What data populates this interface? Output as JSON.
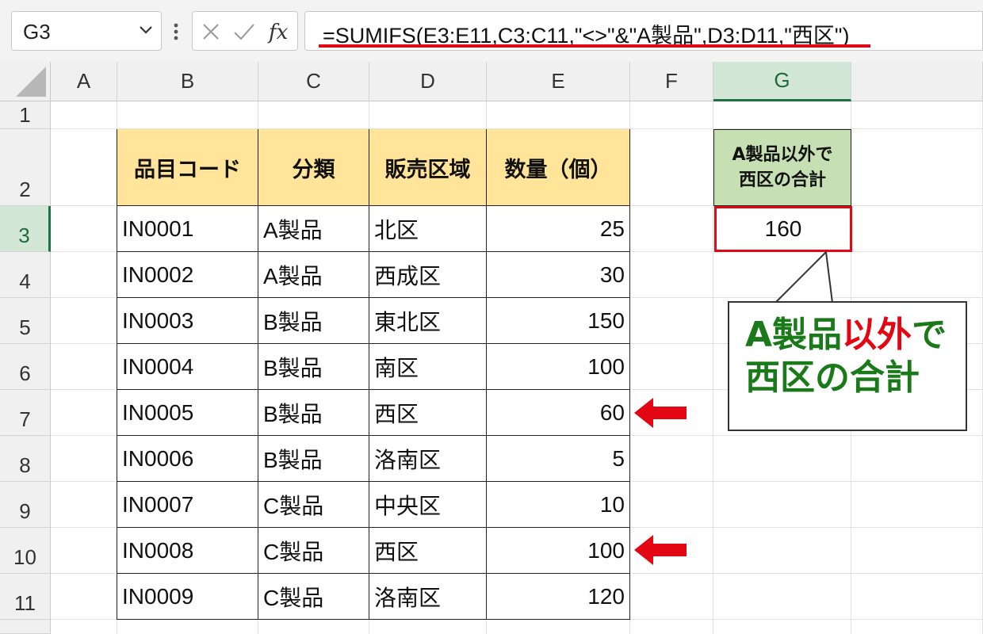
{
  "formula_bar": {
    "name_box": "G3",
    "formula": "=SUMIFS(E3:E11,C3:C11,\"<>\"&\"A製品\",D3:D11,\"西区\")"
  },
  "sheet": {
    "columns": [
      "A",
      "B",
      "C",
      "D",
      "E",
      "F",
      "G"
    ],
    "rows": [
      "1",
      "2",
      "3",
      "4",
      "5",
      "6",
      "7",
      "8",
      "9",
      "10",
      "11"
    ],
    "selected_cell": "G3"
  },
  "table": {
    "headers": [
      "品目コード",
      "分類",
      "販売区域",
      "数量（個）"
    ],
    "rows": [
      [
        "IN0001",
        "A製品",
        "北区",
        "25"
      ],
      [
        "IN0002",
        "A製品",
        "西成区",
        "30"
      ],
      [
        "IN0003",
        "B製品",
        "東北区",
        "150"
      ],
      [
        "IN0004",
        "B製品",
        "南区",
        "100"
      ],
      [
        "IN0005",
        "B製品",
        "西区",
        "60"
      ],
      [
        "IN0006",
        "B製品",
        "洛南区",
        "5"
      ],
      [
        "IN0007",
        "C製品",
        "中央区",
        "10"
      ],
      [
        "IN0008",
        "C製品",
        "西区",
        "100"
      ],
      [
        "IN0009",
        "C製品",
        "洛南区",
        "120"
      ]
    ]
  },
  "result": {
    "header_line1": "A製品以外で",
    "header_line2": "西区の合計",
    "value": "160"
  },
  "callout": {
    "part1": "A製品",
    "part2": "以外",
    "part3": "で",
    "line2": "西区の合計"
  },
  "colors": {
    "header_fill": "#ffe49a",
    "result_header_fill": "#c6e0b4",
    "highlight_red": "#e30613",
    "callout_green": "#1a7a1a"
  }
}
